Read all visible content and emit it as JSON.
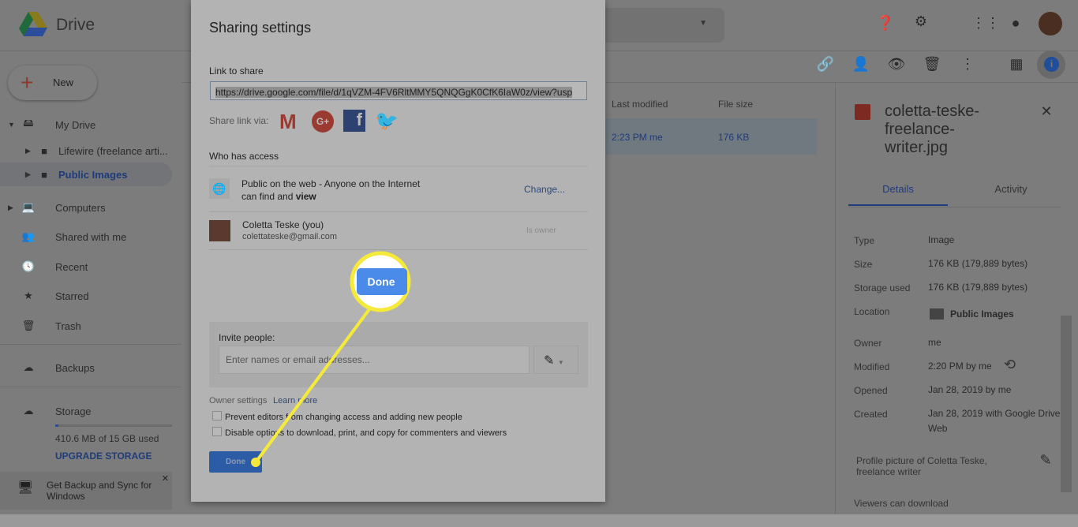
{
  "app": {
    "name": "Drive"
  },
  "sidebar": {
    "new_label": "New",
    "items": [
      {
        "label": "My Drive",
        "icon": "drive-icon"
      },
      {
        "label": "Lifewire (freelance arti...",
        "icon": "folder-icon"
      },
      {
        "label": "Public Images",
        "icon": "folder-icon"
      },
      {
        "label": "Computers",
        "icon": "computer-icon"
      },
      {
        "label": "Shared with me",
        "icon": "people-icon"
      },
      {
        "label": "Recent",
        "icon": "clock-icon"
      },
      {
        "label": "Starred",
        "icon": "star-icon"
      },
      {
        "label": "Trash",
        "icon": "trash-icon"
      },
      {
        "label": "Backups",
        "icon": "cloud-icon"
      },
      {
        "label": "Storage",
        "icon": "cloud-outline-icon"
      }
    ],
    "storage_used": "410.6 MB of 15 GB used",
    "storage_fraction": 0.027,
    "upgrade_label": "UPGRADE STORAGE",
    "backup_promo": "Get Backup and Sync for Windows"
  },
  "filelist": {
    "headers": [
      "Last modified",
      "File size"
    ],
    "row": {
      "modified": "2:23 PM me",
      "size": "176 KB"
    }
  },
  "details": {
    "filename": "coletta-teske-freelance-writer.jpg",
    "tabs": [
      "Details",
      "Activity"
    ],
    "rows": [
      [
        "Type",
        "Image"
      ],
      [
        "Size",
        "176 KB (179,889 bytes)"
      ],
      [
        "Storage used",
        "176 KB (179,889 bytes)"
      ],
      [
        "Location",
        "Public Images"
      ],
      [
        "Owner",
        "me"
      ],
      [
        "Modified",
        "2:20 PM by me"
      ],
      [
        "Opened",
        "Jan 28, 2019 by me"
      ],
      [
        "Created",
        "Jan 28, 2019 with Google Drive Web"
      ]
    ],
    "description": "Profile picture of Coletta Teske, freelance writer",
    "viewers": "Viewers can download"
  },
  "dialog": {
    "title": "Sharing settings",
    "link_label": "Link to share",
    "link": "https://drive.google.com/file/d/1qVZM-4FV6RltMMY5QNQGgK0CfK6IaW0z/view?usp",
    "share_via": "Share link via:",
    "who": "Who has access",
    "public_text": "Public on the web - Anyone on the Internet",
    "public_text2": "can find and ",
    "public_bold": "view",
    "change": "Change...",
    "owner_name": "Coletta Teske (you)",
    "owner_email": "colettateske@gmail.com",
    "owner_role": "Is owner",
    "invite_label": "Invite people:",
    "invite_placeholder": "Enter names or email addresses...",
    "owner_settings": "Owner settings",
    "learn_more": "Learn more",
    "opt1": "Prevent editors from changing access and adding new people",
    "opt2": "Disable options to download, print, and copy for commenters and viewers",
    "done": "Done",
    "callout": "Done"
  },
  "colors": {
    "highlight": "#f5e93a",
    "done_blue": "#3a78d4"
  }
}
